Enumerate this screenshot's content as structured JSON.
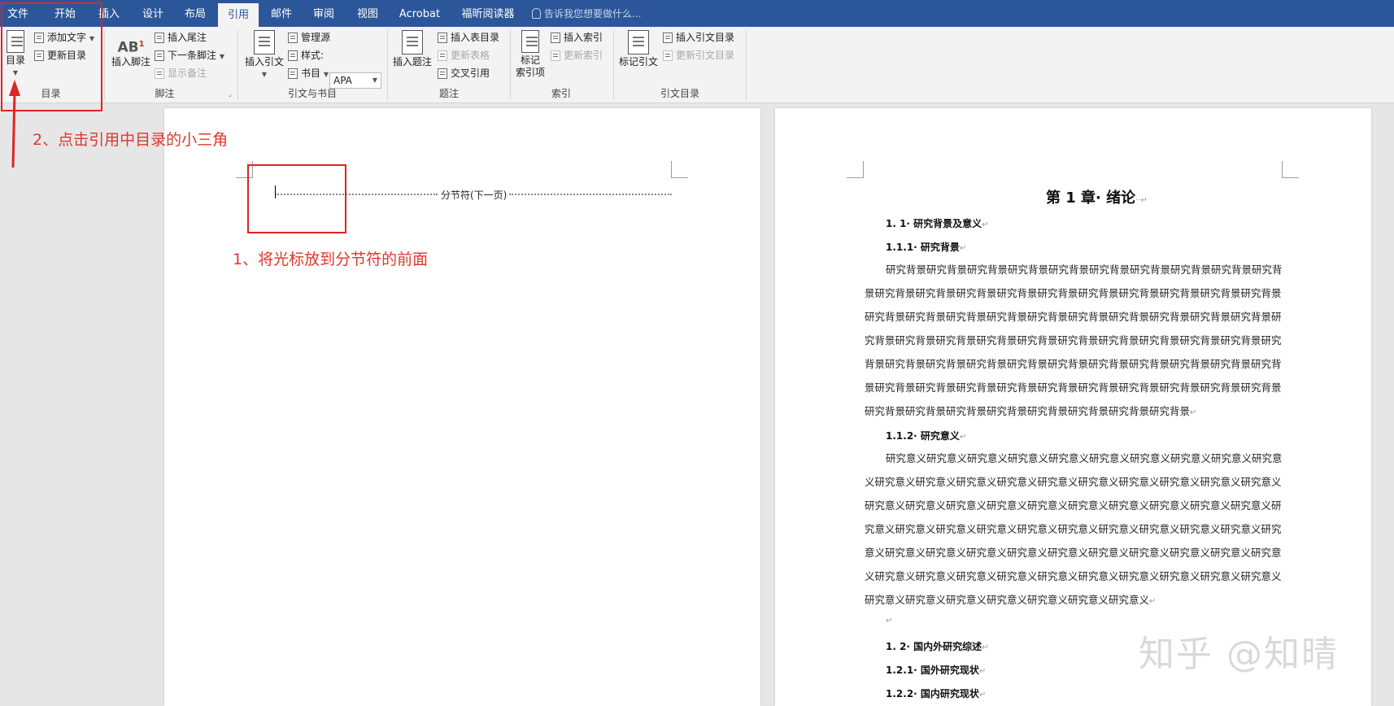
{
  "menu": {
    "tabs": [
      "文件",
      "开始",
      "插入",
      "设计",
      "布局",
      "引用",
      "邮件",
      "审阅",
      "视图",
      "Acrobat",
      "福昕阅读器"
    ],
    "tell_me": "告诉我您想要做什么..."
  },
  "ribbon": {
    "toc": {
      "toc_button": "目录",
      "add_text": "添加文字",
      "update_toc": "更新目录",
      "group": "目录"
    },
    "footnotes": {
      "insert_footnote": "插入脚注",
      "insert_endnote": "插入尾注",
      "next_footnote": "下一条脚注",
      "show_notes": "显示备注",
      "group": "脚注"
    },
    "citations": {
      "insert_citation": "插入引文",
      "manage_sources": "管理源",
      "style_label": "样式:",
      "style_value": "APA",
      "bibliography": "书目",
      "group": "引文与书目"
    },
    "captions": {
      "insert_caption": "插入题注",
      "insert_table_of_figures": "插入表目录",
      "update_table": "更新表格",
      "cross_reference": "交叉引用",
      "group": "题注"
    },
    "index": {
      "mark_entry_line1": "标记",
      "mark_entry_line2": "索引项",
      "insert_index": "插入索引",
      "update_index": "更新索引",
      "group": "索引"
    },
    "authorities": {
      "mark_citation": "标记引文",
      "insert_toa": "插入引文目录",
      "update_toa": "更新引文目录",
      "group": "引文目录"
    }
  },
  "annotations": {
    "step2": "2、点击引用中目录的小三角",
    "step1": "1、将光标放到分节符的前面"
  },
  "page1": {
    "section_break": "分节符(下一页)"
  },
  "page2": {
    "chapter_title": "第 1 章· 绪论",
    "h1_1": "1. 1· 研究背景及意义",
    "h1_1_1": "1.1.1· 研究背景",
    "para_background": "研究背景研究背景研究背景研究背景研究背景研究背景研究背景研究背景研究背景研究背景研究背景研究背景研究背景研究背景研究背景研究背景研究背景研究背景研究背景研究背景研究背景研究背景研究背景研究背景研究背景研究背景研究背景研究背景研究背景研究背景研究背景研究背景研究背景研究背景研究背景研究背景研究背景研究背景研究背景研究背景研究背景研究背景研究背景研究背景研究背景研究背景研究背景研究背景研究背景研究背景研究背景研究背景研究背景研究背景研究背景研究背景研究背景研究背景研究背景研究背景研究背景研究背景研究背景研究背景研究背景研究背景研究背景研究背景研究背景",
    "h1_1_2": "1.1.2· 研究意义",
    "para_significance": "研究意义研究意义研究意义研究意义研究意义研究意义研究意义研究意义研究意义研究意义研究意义研究意义研究意义研究意义研究意义研究意义研究意义研究意义研究意义研究意义研究意义研究意义研究意义研究意义研究意义研究意义研究意义研究意义研究意义研究意义研究意义研究意义研究意义研究意义研究意义研究意义研究意义研究意义研究意义研究意义研究意义研究意义研究意义研究意义研究意义研究意义研究意义研究意义研究意义研究意义研究意义研究意义研究意义研究意义研究意义研究意义研究意义研究意义研究意义研究意义研究意义研究意义研究意义研究意义研究意义研究意义研究意义研究意义",
    "h1_2": "1. 2· 国内外研究综述",
    "h1_2_1": "1.2.1· 国外研究现状",
    "h1_2_2": "1.2.2· 国内研究现状"
  },
  "watermark": "知乎 @知晴",
  "colors": {
    "menu_bar": "#2b579a",
    "annotation": "#e02424"
  }
}
